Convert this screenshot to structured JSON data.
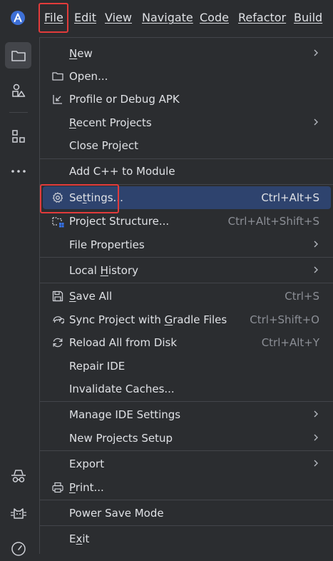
{
  "menubar": {
    "items": [
      {
        "label": "File",
        "mnemonic": "F"
      },
      {
        "label": "Edit",
        "mnemonic": "E"
      },
      {
        "label": "View",
        "mnemonic": "V"
      },
      {
        "label": "Navigate",
        "mnemonic": "N"
      },
      {
        "label": "Code",
        "mnemonic": "C"
      },
      {
        "label": "Refactor",
        "mnemonic": "R"
      },
      {
        "label": "Build",
        "mnemonic": "B"
      }
    ]
  },
  "file_menu": {
    "items": [
      {
        "pre": "",
        "ul": "N",
        "post": "ew",
        "submenu": true
      },
      {
        "pre": "Open...",
        "ul": "",
        "post": ""
      },
      {
        "pre": "Profile or Debug APK",
        "ul": "",
        "post": ""
      },
      {
        "pre": "",
        "ul": "R",
        "post": "ecent Projects",
        "submenu": true
      },
      {
        "pre": "Close Project",
        "ul": "",
        "post": ""
      },
      {
        "pre": "Add C++ to Module",
        "ul": "",
        "post": ""
      },
      {
        "pre": "Se",
        "ul": "t",
        "post": "tings...",
        "shortcut": "Ctrl+Alt+S"
      },
      {
        "pre": "Project Structure...",
        "ul": "",
        "post": "",
        "shortcut": "Ctrl+Alt+Shift+S"
      },
      {
        "pre": "File Properties",
        "ul": "",
        "post": "",
        "submenu": true
      },
      {
        "pre": "Local ",
        "ul": "H",
        "post": "istory",
        "submenu": true
      },
      {
        "pre": "",
        "ul": "S",
        "post": "ave All",
        "shortcut": "Ctrl+S"
      },
      {
        "pre": "Sync Project with ",
        "ul": "G",
        "post": "radle Files",
        "shortcut": "Ctrl+Shift+O"
      },
      {
        "pre": "Reload All from Disk",
        "ul": "",
        "post": "",
        "shortcut": "Ctrl+Alt+Y"
      },
      {
        "pre": "Repair IDE",
        "ul": "",
        "post": ""
      },
      {
        "pre": "Invalidate Caches...",
        "ul": "",
        "post": ""
      },
      {
        "pre": "Manage IDE Settings",
        "ul": "",
        "post": "",
        "submenu": true
      },
      {
        "pre": "New Projects Setup",
        "ul": "",
        "post": "",
        "submenu": true
      },
      {
        "pre": "Export",
        "ul": "",
        "post": "",
        "submenu": true
      },
      {
        "pre": "",
        "ul": "P",
        "post": "rint...",
        "shortcut": ""
      },
      {
        "pre": "Power Save Mode",
        "ul": "",
        "post": ""
      },
      {
        "pre": "E",
        "ul": "x",
        "post": "it"
      }
    ]
  },
  "icons": {
    "toolstrip": [
      "project-folder-icon",
      "resource-manager-icon",
      "structure-icon",
      "more-tools-icon",
      "incognito-icon",
      "cat-icon",
      "dashboard-icon"
    ]
  },
  "colors": {
    "selection": "#2e436e",
    "highlight_box": "#e23b3b",
    "accent_blue": "#3574f0"
  }
}
